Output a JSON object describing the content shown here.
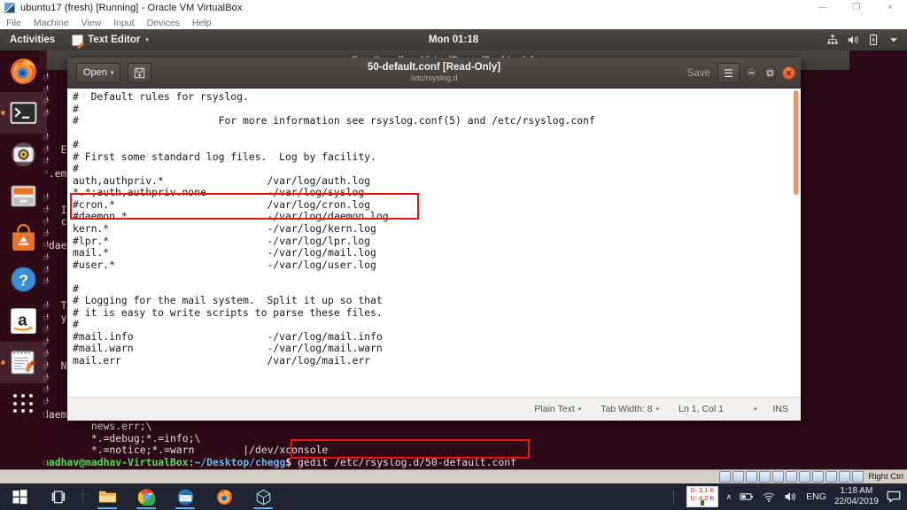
{
  "host_window": {
    "title": "ubuntu17 (fresh) [Running] - Oracle VM VirtualBox",
    "menu": [
      "File",
      "Machine",
      "View",
      "Input",
      "Devices",
      "Help"
    ],
    "controls": {
      "minimize": "—",
      "restore": "❐",
      "close": "×"
    }
  },
  "unity_panel": {
    "activities": "Activities",
    "app_name": "Text Editor",
    "caret": "▾",
    "clock": "Mon 01:18",
    "tray_icons": [
      "network-icon",
      "volume-icon",
      "battery-icon",
      "system-menu-caret-icon"
    ]
  },
  "launcher": {
    "items": [
      {
        "name": "firefox",
        "label": "Firefox",
        "active": false
      },
      {
        "name": "terminal",
        "label": "Terminal",
        "active": true
      },
      {
        "name": "rhythmbox",
        "label": "Rhythmbox",
        "active": false
      },
      {
        "name": "files",
        "label": "Files",
        "active": false
      },
      {
        "name": "ubuntu-software",
        "label": "Ubuntu Software",
        "active": false
      },
      {
        "name": "help",
        "label": "Help",
        "active": false
      },
      {
        "name": "amazon",
        "label": "Amazon",
        "active": false
      },
      {
        "name": "text-editor",
        "label": "Text Editor",
        "active": true
      }
    ],
    "show_apps_label": "Show Applications"
  },
  "terminal": {
    "title": "madhav@madhav-VirtualBox: ~/Desktop/chegg",
    "scrollback": [
      "#",
      "#",
      "#",
      "#",
      "",
      "#",
      "#  Em",
      "#",
      "*.em",
      "",
      "#",
      "#  I",
      "#  co",
      "#",
      "#dae",
      "#",
      "#",
      "#",
      "",
      "#  Th",
      "#  yo",
      "#",
      "#",
      "#",
      "#  NO",
      "#",
      "#",
      "#",
      "daemon.*;mail.*;\\",
      "        news.err;\\",
      "        *.=debug;*.=info;\\",
      "        *.=notice;*.=warn        |/dev/xconsole"
    ],
    "prompt_user": "madhav@madhav-VirtualBox",
    "prompt_sep": ":",
    "prompt_path": "~/Desktop/chegg",
    "prompt_dollar": "$",
    "command": "gedit /etc/rsyslog.d/50-default.conf"
  },
  "gedit": {
    "open_button": "Open",
    "open_caret": "▾",
    "save_icon": "save-icon",
    "title": "50-default.conf [Read-Only]",
    "subtitle": "/etc/rsyslog.d",
    "save_button": "Save",
    "menu_button": "☰",
    "window_controls": {
      "minimize": "−",
      "maximize": "□",
      "close": "×"
    },
    "content": [
      "#  Default rules for rsyslog.",
      "#",
      "#                       For more information see rsyslog.conf(5) and /etc/rsyslog.conf",
      "",
      "#",
      "# First some standard log files.  Log by facility.",
      "#",
      "auth,authpriv.*                 /var/log/auth.log",
      "*.*;auth,authpriv.none          -/var/log/syslog",
      "#cron.*                         /var/log/cron.log",
      "#daemon.*                       -/var/log/daemon.log",
      "kern.*                          -/var/log/kern.log",
      "#lpr.*                          -/var/log/lpr.log",
      "mail.*                          -/var/log/mail.log",
      "#user.*                         -/var/log/user.log",
      "",
      "#",
      "# Logging for the mail system.  Split it up so that",
      "# it is easy to write scripts to parse these files.",
      "#",
      "#mail.info                      -/var/log/mail.info",
      "#mail.warn                      -/var/log/mail.warn",
      "mail.err                        /var/log/mail.err"
    ],
    "status": {
      "language": "Plain Text",
      "tab_width": "Tab Width: 8",
      "position": "Ln 1, Col 1",
      "insert_mode": "INS",
      "caret": "▾"
    }
  },
  "annotations": [
    {
      "name": "highlight-cron-daemon-lines"
    },
    {
      "name": "highlight-gedit-command"
    }
  ],
  "vbox_status": {
    "right_ctrl_label": "Right Ctrl",
    "icon_count": 12
  },
  "windows_taskbar": {
    "items": [
      {
        "name": "start-button",
        "running": false
      },
      {
        "name": "task-view-button",
        "running": false
      },
      {
        "name": "file-explorer",
        "running": true
      },
      {
        "name": "chrome",
        "running": true
      },
      {
        "name": "mail",
        "running": true
      },
      {
        "name": "firefox",
        "running": false
      },
      {
        "name": "virtualbox",
        "running": true
      }
    ],
    "tray": {
      "net_down": "D: 3.1 K",
      "net_up": "U: 4.2 K",
      "overflow_caret": "∧",
      "language": "ENG",
      "time": "1:18 AM",
      "date": "22/04/2019",
      "action_center": "action-center-icon"
    }
  },
  "colors": {
    "ubuntu_purple": "#2c0a17",
    "unity_panel": "#3c3936",
    "accent_orange": "#e8732e",
    "annotation_red": "#ee1111",
    "terminal_green": "#57d957",
    "terminal_blue": "#6fb8e8",
    "windows_taskbar": "#1f2430"
  }
}
